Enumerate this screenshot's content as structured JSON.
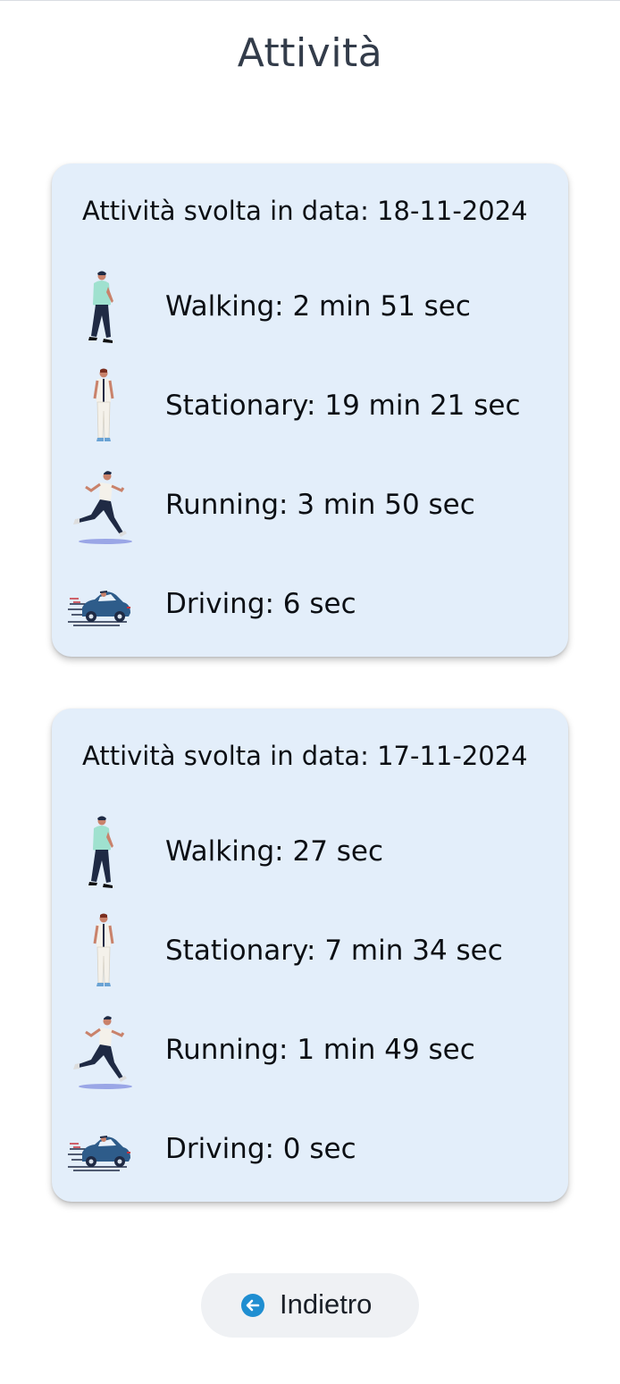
{
  "page": {
    "title": "Attività"
  },
  "cards": [
    {
      "date_label": "Attività svolta in data: 18-11-2024",
      "activities": [
        {
          "icon": "walking-person-icon",
          "label": "Walking: 2 min 51 sec"
        },
        {
          "icon": "standing-person-icon",
          "label": "Stationary: 19 min 21 sec"
        },
        {
          "icon": "running-person-icon",
          "label": "Running: 3 min 50 sec"
        },
        {
          "icon": "driving-car-icon",
          "label": "Driving: 6 sec"
        }
      ]
    },
    {
      "date_label": "Attività svolta in data: 17-11-2024",
      "activities": [
        {
          "icon": "walking-person-icon",
          "label": "Walking: 27 sec"
        },
        {
          "icon": "standing-person-icon",
          "label": "Stationary: 7 min 34 sec"
        },
        {
          "icon": "running-person-icon",
          "label": "Running: 1 min 49 sec"
        },
        {
          "icon": "driving-car-icon",
          "label": "Driving: 0 sec"
        }
      ]
    }
  ],
  "back_button": {
    "label": "Indietro",
    "icon": "arrow-left-circle-icon"
  },
  "colors": {
    "card_background": "#e3eefa",
    "title_color": "#333c4a",
    "back_button_background": "#eff1f4",
    "back_icon_color": "#1f8ed1"
  }
}
